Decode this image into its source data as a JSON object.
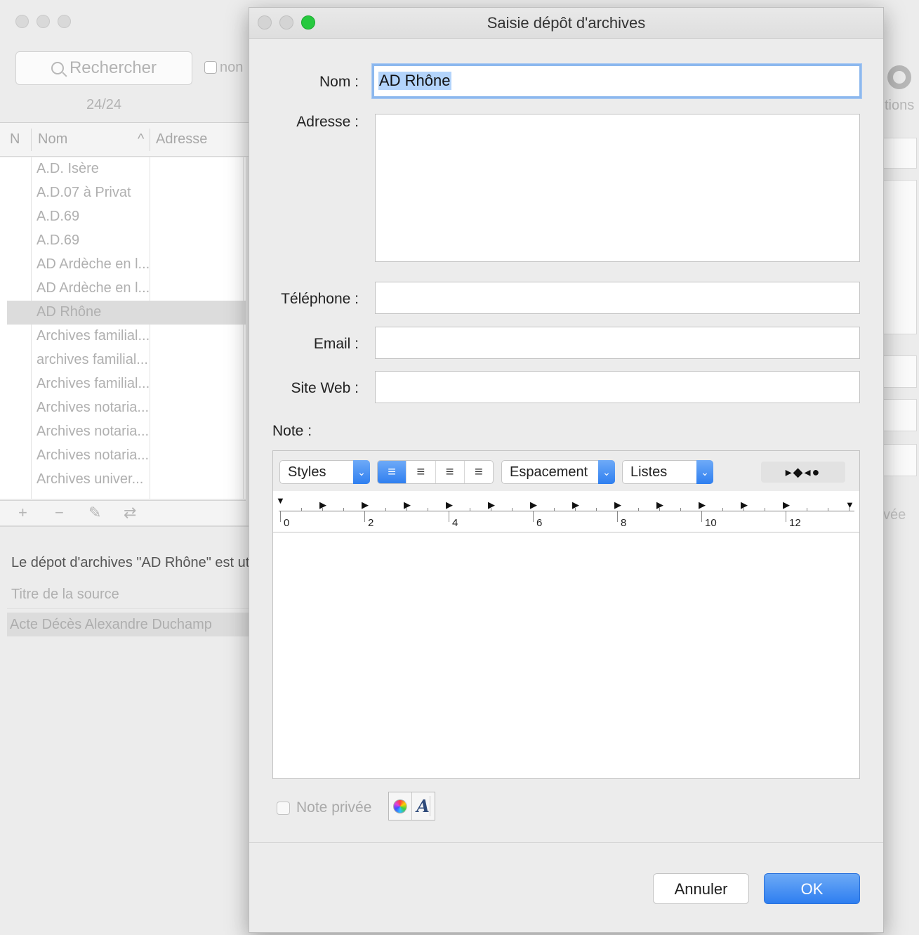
{
  "background": {
    "search_placeholder": "Rechercher",
    "checkbox_label": "non",
    "count": "24/24",
    "columns": [
      "N",
      "Nom",
      "Adresse"
    ],
    "sort_indicator": "^",
    "rows": [
      "A.D. Isère",
      "A.D.07 à Privat",
      "A.D.69",
      "A.D.69",
      "AD Ardèche en l...",
      "AD Ardèche en l...",
      "AD Rhône",
      "Archives familial...",
      "archives familial...",
      "Archives familial...",
      "Archives notaria...",
      "Archives notaria...",
      "Archives notaria...",
      "Archives univer..."
    ],
    "selected_row": "AD Rhône",
    "list_buttons": [
      "+",
      "−",
      "✎",
      "⇄"
    ],
    "usage_text": "Le dépot d'archives \"AD Rhône\" est uti",
    "source_column": "Titre de la source",
    "source_rows": [
      "Acte Décès Alexandre Duchamp"
    ],
    "options_label": "tions",
    "privee_label": "vée"
  },
  "dialog": {
    "title": "Saisie dépôt d'archives",
    "labels": {
      "nom": "Nom :",
      "adresse": "Adresse :",
      "telephone": "Téléphone :",
      "email": "Email :",
      "site_web": "Site Web :",
      "note": "Note :"
    },
    "values": {
      "nom": "AD Rhône",
      "adresse": "",
      "telephone": "",
      "email": "",
      "site_web": "",
      "note": ""
    },
    "toolbar": {
      "styles": "Styles",
      "alignment": [
        "≡",
        "≡",
        "≡",
        "≡"
      ],
      "alignment_selected": "left",
      "espacement": "Espacement",
      "listes": "Listes",
      "tab_stops": "▸◆◂●"
    },
    "ruler_numbers": [
      "0",
      "2",
      "4",
      "6",
      "8",
      "10",
      "12"
    ],
    "note_privee": "Note privée",
    "format_buttons": [
      "color-wheel",
      "A"
    ],
    "buttons": {
      "cancel": "Annuler",
      "ok": "OK"
    },
    "accent_color": "#2f7ff0"
  }
}
